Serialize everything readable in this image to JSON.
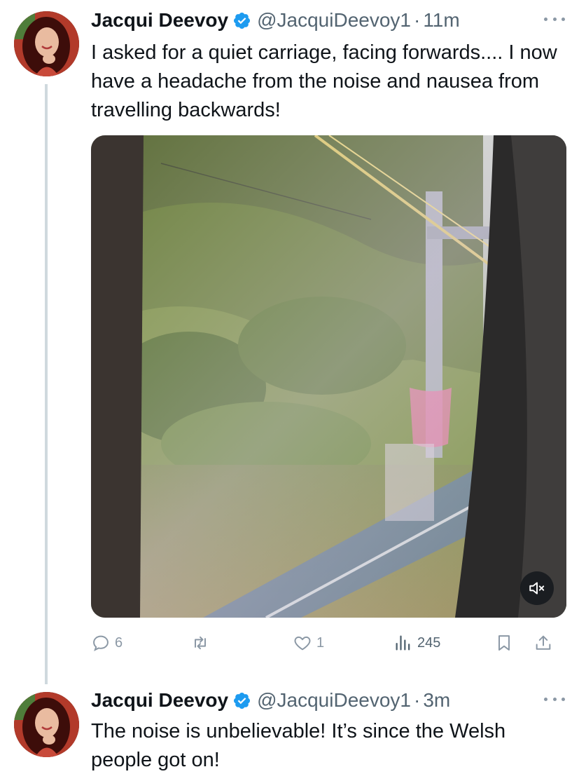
{
  "tweets": [
    {
      "author": "Jacqui Deevoy",
      "handle": "@JacquiDeevoy1",
      "separator": "·",
      "time": "11m",
      "text": "I asked for a quiet carriage, facing forwards.... I now have a headache from the noise and nausea from travelling backwards!",
      "media": {
        "type": "video",
        "description_icon": "volume-muted-icon"
      },
      "actions": {
        "replies": "6",
        "retweets": "",
        "likes": "1",
        "views": "245"
      }
    },
    {
      "author": "Jacqui Deevoy",
      "handle": "@JacquiDeevoy1",
      "separator": "·",
      "time": "3m",
      "text": "The noise is unbelievable! It’s since the Welsh people got on!"
    }
  ],
  "colors": {
    "verified": "#1d9bf0",
    "secondary_text": "#536471",
    "icon": "#8b98a5",
    "thread_line": "#cfd9de"
  },
  "icons": [
    "verified-badge-icon",
    "more-icon",
    "reply-icon",
    "retweet-icon",
    "like-icon",
    "views-icon",
    "bookmark-icon",
    "share-icon",
    "volume-muted-icon"
  ]
}
